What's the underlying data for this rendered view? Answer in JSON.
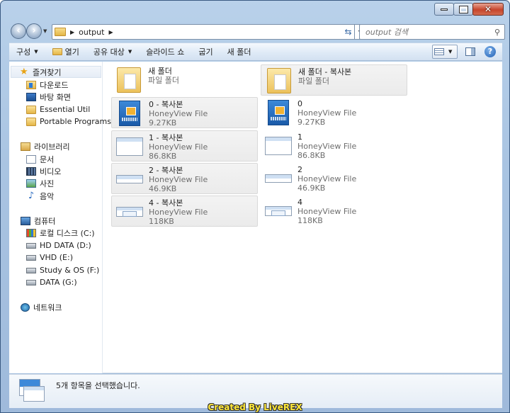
{
  "window": {
    "minimize_label": "minimize",
    "maximize_label": "maximize",
    "close_label": "close"
  },
  "address": {
    "crumbs": [
      "output"
    ]
  },
  "search": {
    "placeholder": "output 검색"
  },
  "toolbar": {
    "organize": "구성",
    "open": "열기",
    "share": "공유 대상",
    "slideshow": "슬라이드 쇼",
    "burn": "굽기",
    "new_folder": "새 폴더"
  },
  "nav": {
    "favorites": "즐겨찾기",
    "downloads": "다운로드",
    "desktop": "바탕 화면",
    "essential_util": "Essential Util",
    "portable_programs": "Portable Programs",
    "libraries": "라이브러리",
    "documents": "문서",
    "videos": "비디오",
    "pictures": "사진",
    "music": "음악",
    "computer": "컴퓨터",
    "local_c": "로컬 디스크 (C:)",
    "hd_data": "HD DATA (D:)",
    "vhd": "VHD (E:)",
    "study_os": "Study & OS (F:)",
    "data_g": "DATA (G:)",
    "network": "네트워크"
  },
  "files": [
    {
      "name": "새 폴더",
      "type": "파일 폴더",
      "size": "",
      "selected": false,
      "thumb": "folder"
    },
    {
      "name": "새 폴더 - 복사본",
      "type": "파일 폴더",
      "size": "",
      "selected": true,
      "thumb": "folder"
    },
    {
      "name": "0 - 복사본",
      "type": "HoneyView File",
      "size": "9.27KB",
      "selected": true,
      "thumb": "honeyview"
    },
    {
      "name": "0",
      "type": "HoneyView File",
      "size": "9.27KB",
      "selected": false,
      "thumb": "honeyview"
    },
    {
      "name": "1 - 복사본",
      "type": "HoneyView File",
      "size": "86.8KB",
      "selected": true,
      "thumb": "window"
    },
    {
      "name": "1",
      "type": "HoneyView File",
      "size": "86.8KB",
      "selected": false,
      "thumb": "window"
    },
    {
      "name": "2 - 복사본",
      "type": "HoneyView File",
      "size": "46.9KB",
      "selected": true,
      "thumb": "window-small"
    },
    {
      "name": "2",
      "type": "HoneyView File",
      "size": "46.9KB",
      "selected": false,
      "thumb": "window-small"
    },
    {
      "name": "4 - 복사본",
      "type": "HoneyView File",
      "size": "118KB",
      "selected": true,
      "thumb": "window-small2"
    },
    {
      "name": "4",
      "type": "HoneyView File",
      "size": "118KB",
      "selected": false,
      "thumb": "window-small2"
    }
  ],
  "details": {
    "status": "5개 항목을 선택했습니다."
  },
  "watermark": "Created By LiveREX"
}
